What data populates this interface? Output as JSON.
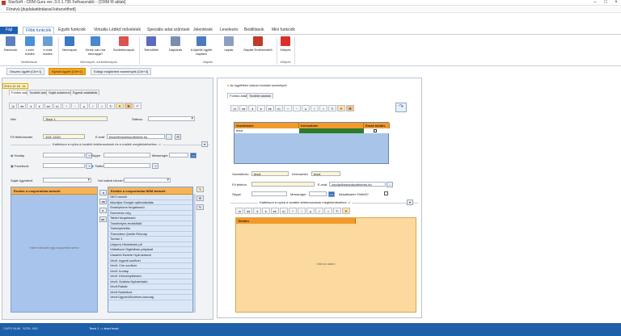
{
  "titlebar": {
    "title": "StarSoft - CRM Guru  ver.:3.0.1.735 Felhasználó:               - [CRM fő ablak]"
  },
  "subtitle": "Fönévü [duplakattintással kiészvétheti]",
  "ribbon": {
    "file_tab": "Fájl",
    "tabs": [
      "Főbb funkciók",
      "Egyéb funkciók",
      "Virtuális Lédikő műveletek",
      "Speciális adat szűrések",
      "Jelentések",
      "Levelezés",
      "Beállítások",
      "Mini funkciók"
    ],
    "buttons": [
      {
        "label": "Sablonok",
        "icon": "template-icon",
        "color": "#5b7fbf"
      },
      {
        "label": "Levél küldés",
        "icon": "mail-icon",
        "color": "#4a90d9"
      },
      {
        "label": "e-mail küldés",
        "icon": "email-icon",
        "color": "#6a9fd4"
      },
      {
        "label": "Névnapok",
        "icon": "nameday-icon",
        "color": "#3a78c2"
      },
      {
        "label": "Kinek van ma névnapja?",
        "icon": "question-icon",
        "color": "#4a87cc"
      },
      {
        "label": "Születésnapok",
        "icon": "gift-icon",
        "color": "#d9534f"
      },
      {
        "label": "Teendőlék",
        "icon": "tasks-icon",
        "color": "#5c6bc0"
      },
      {
        "label": "Naptárak",
        "icon": "calendar-icon",
        "color": "#7a8fb0"
      },
      {
        "label": "A kijelölt ügyfél naptára",
        "icon": "calendar-day-icon",
        "color": "#4a7bbf"
      },
      {
        "label": "naptár",
        "icon": "calendar-small-icon",
        "color": "#8b9fc0"
      },
      {
        "label": "Naptár Emlékeztető",
        "icon": "alarm-icon",
        "color": "#c0392b"
      },
      {
        "label": "Kilépés",
        "icon": "exit-icon",
        "color": "#d9302b"
      }
    ],
    "groups": [
      "Beállítások",
      "Névnapok, születésnapok",
      "Naptár",
      "Kilépés"
    ]
  },
  "doctabs": [
    "Összes ügyfél [Ctrl+1]",
    "Kijelölt ügyfél [Ctrl+2]",
    "Eddigi megtörtént események [Ctrl+3]"
  ],
  "left": {
    "date": "2014.12.15. 11:",
    "subtabs": [
      "Fontos adatok",
      "További adatok",
      "Saját adatmezők",
      "Egyedi adatlátlák"
    ],
    "name_label": "Név",
    "name_value": "Teszt 1",
    "status_label": "Státusz",
    "phone_label": "Fő telefonszám",
    "phone_value": "1111 11111",
    "email_label": "E-mail",
    "email_value": "teszt@egyedszoftverek.hu",
    "click_phones": "Kattintson a nyílra a további telefonszámok és e-mailek megtekintéséhez ->",
    "homepage_label": "Honlap",
    "skype_label": "Skype",
    "messenger_label": "Messenger",
    "facebook_label": "Facebook",
    "twitter_label": "Twitter",
    "own_label": "Saját ügyintéző",
    "found_label": "Hol hallott rólunk?",
    "groups_in_title": "Ezekbe a csoportokba tartozik",
    "groups_in_placeholder": "<Nem tartozik egy csoportba sem>",
    "groups_not_title": "Ezekbe a csoportokba NEM tartozik",
    "groups_not_items": [
      "SEO hendő",
      "Iskonljax Google optimalizálás",
      "Smartphone forgalmazó",
      "Szerverez cég",
      "Tablet forgalmazó",
      "Tárolhelyes érdeklődő",
      "Tárhelyfelelős",
      "Therodera Quelle Rövnap",
      "Tomán 1",
      "Uniperó Hirdetések plf",
      "Vállalkozó Digitálban pályázat",
      "Vásárlói Esdete Hydrokrtaról",
      "Vevő: egyedi szoftver",
      "Vevő: Cim szoftver",
      "Vevő: honlap",
      "Vevő: KéméinyMester",
      "Vevő: Szálela Nyilvántartó",
      "Vevő:Raktár",
      "Vevő:Szálolkod",
      "Vevő:ÜgyvédiSzoftver.csomag"
    ]
  },
  "right": {
    "title": "Az ügyfélhez tartozó kontakt személyek",
    "subtabs": [
      "Fontos adatok",
      "További adatok"
    ],
    "grid_cols": [
      "Vezetéknév",
      "Keresztnév",
      "Email küldés"
    ],
    "grid_row": [
      "teszt",
      ""
    ],
    "lastname_label": "Vezetéknév",
    "lastname_value": "teszt",
    "firstname_label": "Keresztnév",
    "firstname_value": "teszt",
    "phone_label": "Fő telefon",
    "email_label": "E-mail",
    "email_value": "zonda@egyedszoftverek.hu",
    "skype_label": "Skype",
    "messenger_label": "Messenger",
    "newsletter_label": "Aktuálisaim! Feliből?",
    "click_phones": "Kattintson a nyílra a további telefonszámok megtekintéséhez ->",
    "phone_grid_head": "Telefon",
    "phone_grid_placeholder": "<Nincs adat>"
  },
  "statusbar": {
    "caps": "CAPS",
    "num": "NUM",
    "scrl": "SCRL",
    "ins": "INS",
    "record": "Teszt 1 -> teszt teszt"
  }
}
